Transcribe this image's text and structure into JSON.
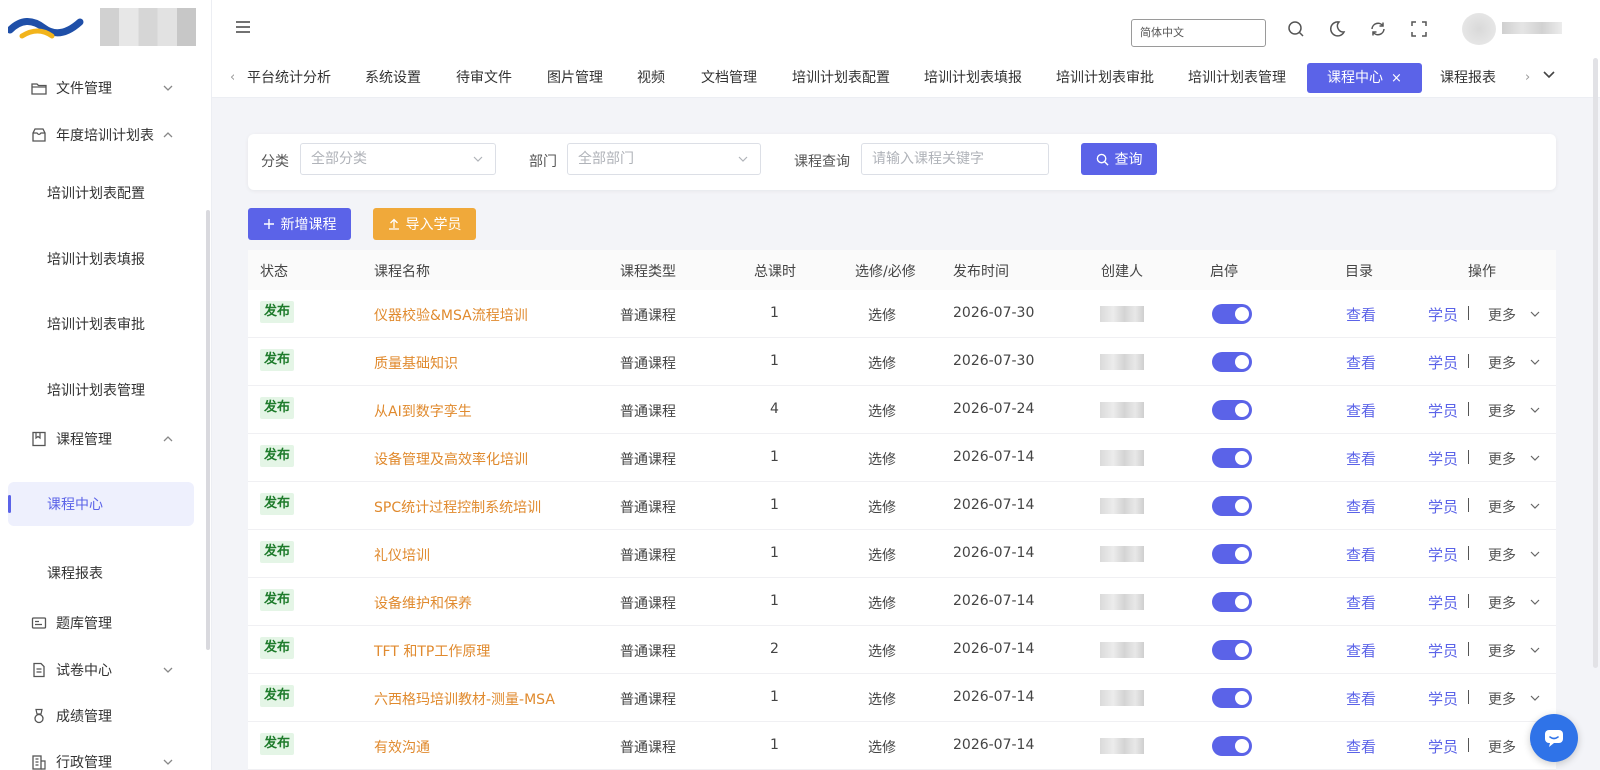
{
  "sidebar": {
    "menus": [
      {
        "label": "文件管理",
        "icon": "folder-icon",
        "arrow": "down"
      },
      {
        "label": "年度培训计划表",
        "icon": "archive-icon",
        "arrow": "up"
      },
      {
        "label": "课程管理",
        "icon": "book-icon",
        "arrow": "up"
      },
      {
        "label": "题库管理",
        "icon": "question-bank-icon",
        "arrow": ""
      },
      {
        "label": "试卷中心",
        "icon": "exam-paper-icon",
        "arrow": "down"
      },
      {
        "label": "成绩管理",
        "icon": "medal-icon",
        "arrow": ""
      },
      {
        "label": "行政管理",
        "icon": "building-icon",
        "arrow": "down"
      }
    ],
    "plan_subitems": [
      "培训计划表配置",
      "培训计划表填报",
      "培训计划表审批",
      "培训计划表管理"
    ],
    "course_subitems": [
      "课程中心",
      "课程报表"
    ]
  },
  "header": {
    "language": "简体中文"
  },
  "tabs": [
    "平台统计分析",
    "系统设置",
    "待审文件",
    "图片管理",
    "视频",
    "文档管理",
    "培训计划表配置",
    "培训计划表填报",
    "培训计划表审批",
    "培训计划表管理",
    "课程中心",
    "课程报表"
  ],
  "active_tab_close": "×",
  "filters": {
    "category_label": "分类",
    "category_placeholder": "全部分类",
    "dept_label": "部门",
    "dept_placeholder": "全部部门",
    "query_label": "课程查询",
    "query_placeholder": "请输入课程关键字",
    "query_button": "查询"
  },
  "actions": {
    "add_course": "新增课程",
    "import_students": "导入学员"
  },
  "table": {
    "headers": [
      "状态",
      "课程名称",
      "课程类型",
      "总课时",
      "选修/必修",
      "发布时间",
      "创建人",
      "启停",
      "目录",
      "操作"
    ],
    "rows": [
      {
        "status": "发布",
        "name": "仪器校验&MSA流程培训",
        "type": "普通课程",
        "hours": "1",
        "elective": "选修",
        "date": "2026-07-30"
      },
      {
        "status": "发布",
        "name": "质量基础知识",
        "type": "普通课程",
        "hours": "1",
        "elective": "选修",
        "date": "2026-07-30"
      },
      {
        "status": "发布",
        "name": "从AI到数字孪生",
        "type": "普通课程",
        "hours": "4",
        "elective": "选修",
        "date": "2026-07-24"
      },
      {
        "status": "发布",
        "name": "设备管理及高效率化培训",
        "type": "普通课程",
        "hours": "1",
        "elective": "选修",
        "date": "2026-07-14"
      },
      {
        "status": "发布",
        "name": "SPC统计过程控制系统培训",
        "type": "普通课程",
        "hours": "1",
        "elective": "选修",
        "date": "2026-07-14"
      },
      {
        "status": "发布",
        "name": "礼仪培训",
        "type": "普通课程",
        "hours": "1",
        "elective": "选修",
        "date": "2026-07-14"
      },
      {
        "status": "发布",
        "name": "设备维护和保养",
        "type": "普通课程",
        "hours": "1",
        "elective": "选修",
        "date": "2026-07-14"
      },
      {
        "status": "发布",
        "name": "TFT 和TP工作原理",
        "type": "普通课程",
        "hours": "2",
        "elective": "选修",
        "date": "2026-07-14"
      },
      {
        "status": "发布",
        "name": "六西格玛培训教材-测量-MSA",
        "type": "普通课程",
        "hours": "1",
        "elective": "选修",
        "date": "2026-07-14"
      },
      {
        "status": "发布",
        "name": "有效沟通",
        "type": "普通课程",
        "hours": "1",
        "elective": "选修",
        "date": "2026-07-14"
      }
    ],
    "toggle_on": true,
    "view_label": "查看",
    "students_label": "学员",
    "more_label": "更多"
  },
  "colors": {
    "primary": "#5b63e8",
    "warning": "#f0a93a",
    "course_name": "#e08a2e",
    "published_bg": "#e4f5e6",
    "published_text": "#1e7b2b"
  }
}
